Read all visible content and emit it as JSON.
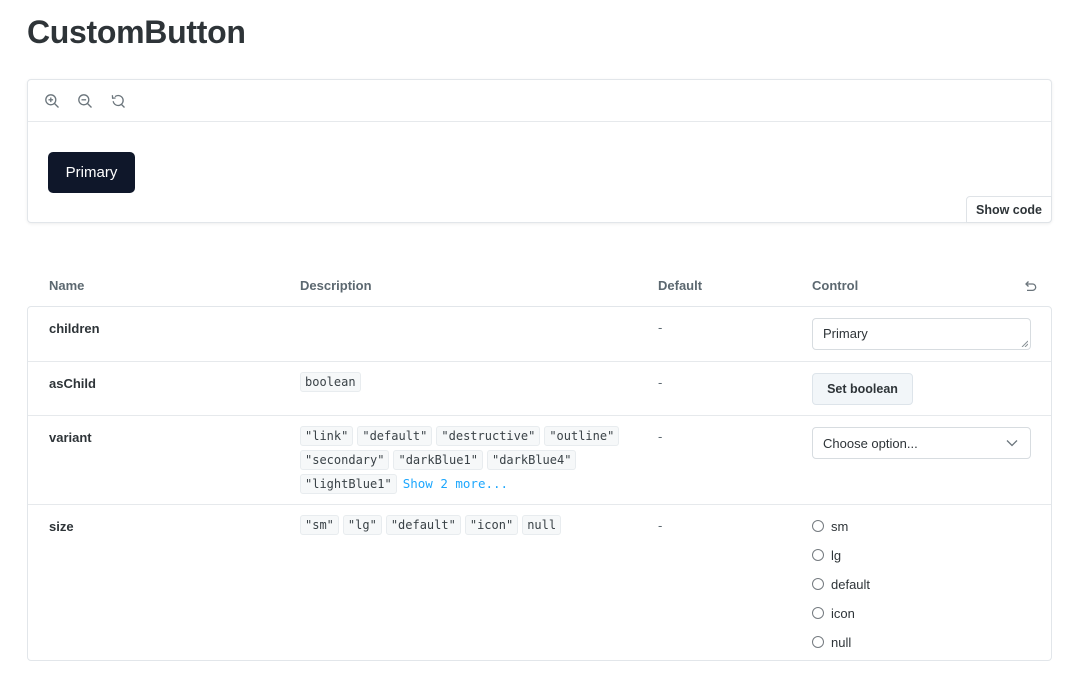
{
  "page": {
    "title": "CustomButton"
  },
  "preview": {
    "tools": [
      "zoom-in-icon",
      "zoom-out-icon",
      "reset-zoom-icon"
    ],
    "demo_button_label": "Primary",
    "show_code_label": "Show code"
  },
  "table": {
    "headers": {
      "name": "Name",
      "description": "Description",
      "default": "Default",
      "control": "Control"
    },
    "rows": {
      "children": {
        "name": "children",
        "default": "-",
        "control_value": "Primary"
      },
      "asChild": {
        "name": "asChild",
        "types": [
          "boolean"
        ],
        "default": "-",
        "control_label": "Set boolean"
      },
      "variant": {
        "name": "variant",
        "types": [
          "\"link\"",
          "\"default\"",
          "\"destructive\"",
          "\"outline\"",
          "\"secondary\"",
          "\"darkBlue1\"",
          "\"darkBlue4\"",
          "\"lightBlue1\""
        ],
        "show_more": "Show 2 more...",
        "default": "-",
        "control_placeholder": "Choose option..."
      },
      "size": {
        "name": "size",
        "types": [
          "\"sm\"",
          "\"lg\"",
          "\"default\"",
          "\"icon\"",
          "null"
        ],
        "default": "-",
        "options": [
          "sm",
          "lg",
          "default",
          "icon",
          "null"
        ]
      }
    }
  },
  "colors": {
    "accent": "#1ea7fd",
    "demo_button_bg": "#0f172a"
  }
}
